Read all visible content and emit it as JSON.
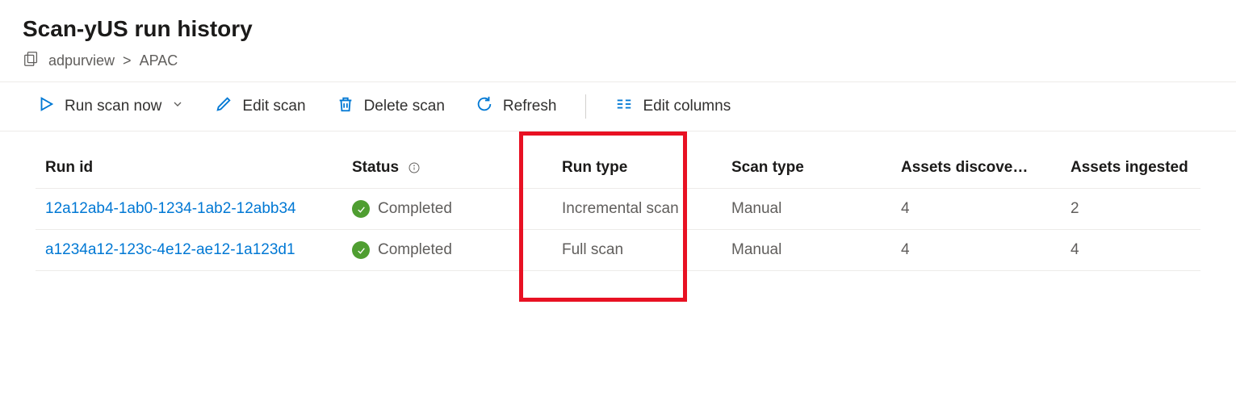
{
  "header": {
    "title": "Scan-yUS run history",
    "breadcrumb_root": "adpurview",
    "breadcrumb_sep": ">",
    "breadcrumb_leaf": "APAC"
  },
  "toolbar": {
    "run_scan": "Run scan now",
    "edit_scan": "Edit scan",
    "delete_scan": "Delete scan",
    "refresh": "Refresh",
    "edit_columns": "Edit columns"
  },
  "columns": {
    "run_id": "Run id",
    "status": "Status",
    "run_type": "Run type",
    "scan_type": "Scan type",
    "assets_discovered": "Assets discove…",
    "assets_ingested": "Assets ingested"
  },
  "rows": [
    {
      "run_id": "12a12ab4-1ab0-1234-1ab2-12abb34",
      "status": "Completed",
      "run_type": "Incremental scan",
      "scan_type": "Manual",
      "assets_discovered": "4",
      "assets_ingested": "2"
    },
    {
      "run_id": "a1234a12-123c-4e12-ae12-1a123d1",
      "status": "Completed",
      "run_type": "Full scan",
      "scan_type": "Manual",
      "assets_discovered": "4",
      "assets_ingested": "4"
    }
  ]
}
